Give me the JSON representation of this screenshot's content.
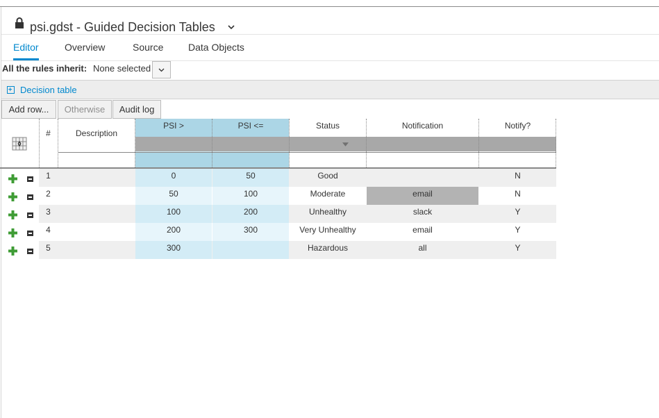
{
  "header": {
    "title": "psi.gdst - Guided Decision Tables"
  },
  "tabs": [
    {
      "label": "Editor",
      "active": true
    },
    {
      "label": "Overview",
      "active": false
    },
    {
      "label": "Source",
      "active": false
    },
    {
      "label": "Data Objects",
      "active": false
    }
  ],
  "inherit": {
    "label": "All the rules inherit:",
    "value": "None selected"
  },
  "decision_table": {
    "label": "Decision table"
  },
  "toolbar": {
    "add_row": "Add row...",
    "otherwise": "Otherwise",
    "audit_log": "Audit log"
  },
  "columns": {
    "num": "#",
    "description": "Description",
    "psi_gt": "PSI >",
    "psi_le": "PSI <=",
    "status": "Status",
    "notification": "Notification",
    "notify": "Notify?"
  },
  "rows": [
    {
      "num": "1",
      "description": "",
      "psi_gt": "0",
      "psi_le": "50",
      "status": "Good",
      "notification": "",
      "notify": "N"
    },
    {
      "num": "2",
      "description": "",
      "psi_gt": "50",
      "psi_le": "100",
      "status": "Moderate",
      "notification": "email",
      "notify": "N"
    },
    {
      "num": "3",
      "description": "",
      "psi_gt": "100",
      "psi_le": "200",
      "status": "Unhealthy",
      "notification": "slack",
      "notify": "Y"
    },
    {
      "num": "4",
      "description": "",
      "psi_gt": "200",
      "psi_le": "300",
      "status": "Very Unhealthy",
      "notification": "email",
      "notify": "Y"
    },
    {
      "num": "5",
      "description": "",
      "psi_gt": "300",
      "psi_le": "",
      "status": "Hazardous",
      "notification": "all",
      "notify": "Y"
    }
  ],
  "colors": {
    "accent": "#0088ce",
    "selected_column": "#d3ecf6",
    "selected_header": "#acd6e6",
    "pattern_bar": "#a8a8a8",
    "selected_cell": "#b3b3b3",
    "add_icon": "#3f9c35"
  },
  "icons": {
    "lock": "lock-icon",
    "title_dropdown": "chevron-down-icon",
    "inherit_dropdown": "chevron-down-icon",
    "decision_table_toggle": "expand-plus-icon",
    "table_corner": "column-swap-icon",
    "pattern_dropdown": "caret-down-icon",
    "row_add": "add-row-icon",
    "row_remove": "remove-row-icon"
  }
}
